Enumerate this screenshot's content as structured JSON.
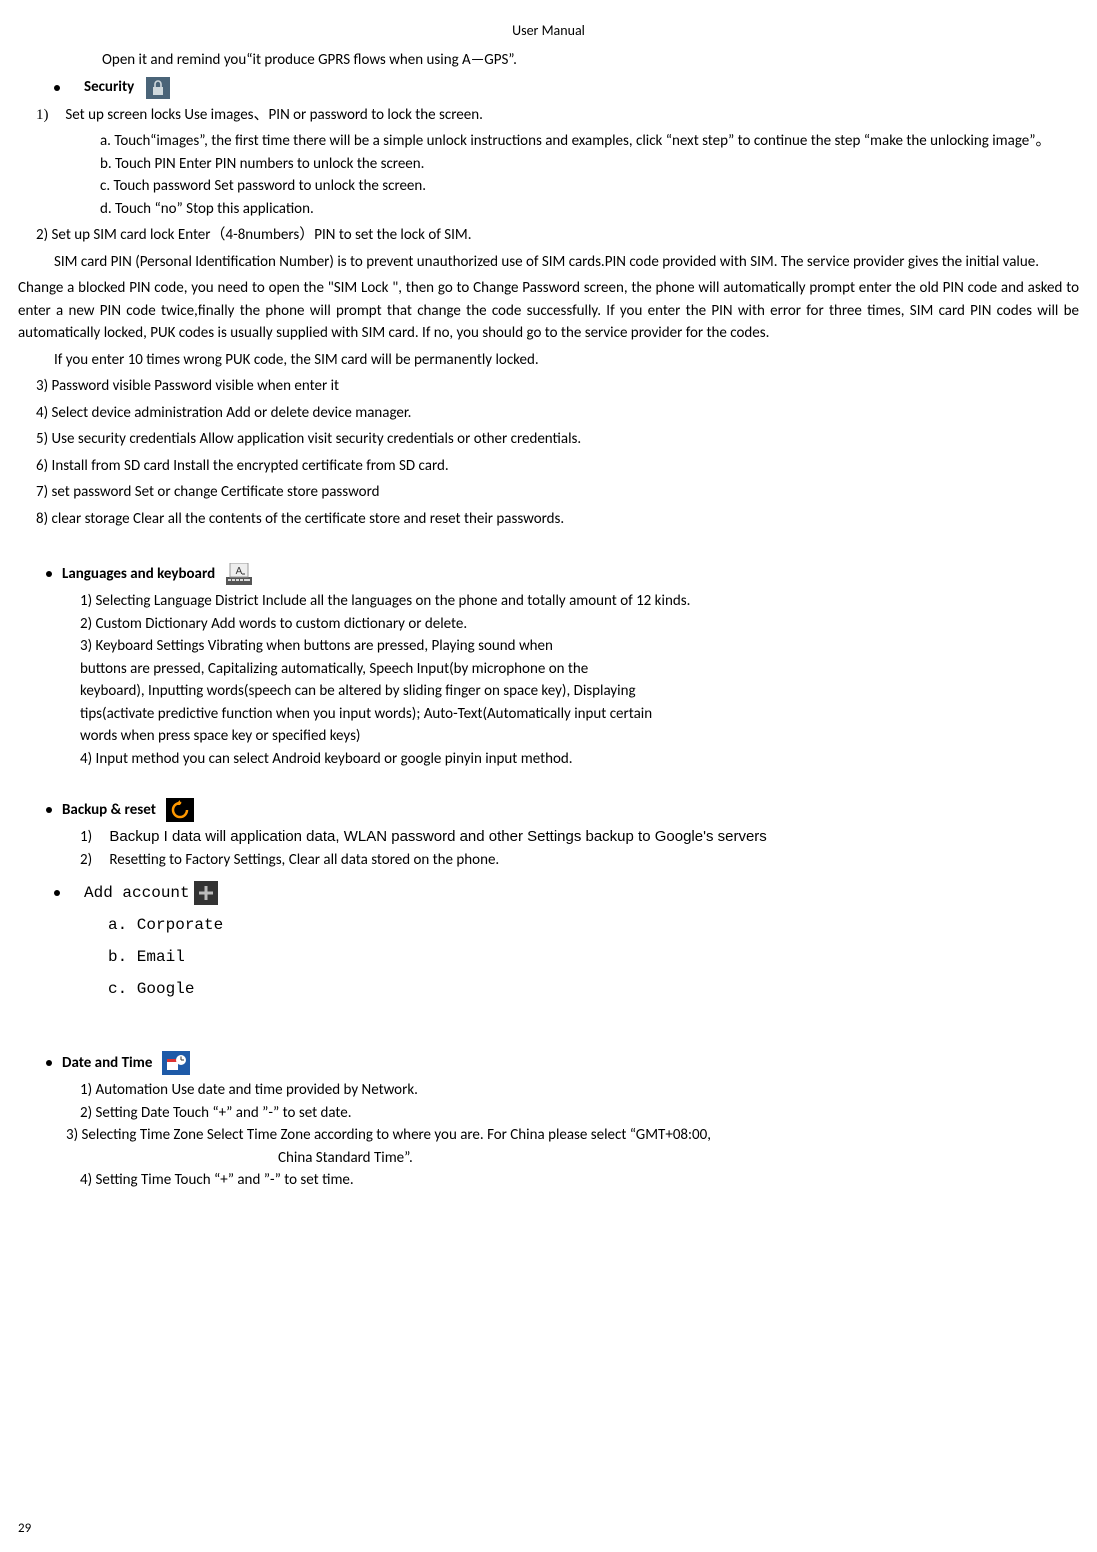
{
  "header": {
    "title": "User    Manual"
  },
  "intro": "Open it and remind you“it produce GPRS flows when using A—GPS”.",
  "security": {
    "label": "Security",
    "item1": {
      "num": "1)",
      "text": "Set up screen locks      Use images、PIN or password to lock the screen.",
      "a": "a. Touch“images”,    the first time there will be a simple unlock instructions and examples, click “next step” to continue the step “make the unlocking image”。",
      "b": "b. Touch PIN Enter PIN numbers to unlock the screen.",
      "c": "c. Touch password      Set password to unlock the screen.",
      "d": "d. Touch “no”      Stop this application."
    },
    "item2": "2)    Set up SIM card lock      Enter（4-8numbers）PIN to set the lock of SIM.",
    "simpin1": "SIM card PIN (Personal Identification Number) is to prevent unauthorized use of SIM cards.PIN code provided with SIM. The service provider gives the initial value.",
    "para_change": "Change a blocked PIN code, you need to open the \"SIM Lock \", then go to Change Password screen, the phone will automatically prompt enter the old PIN code and asked to enter a new PIN code twice,finally the phone will prompt that change the code successfully. If you enter the PIN with error for three times, SIM card PIN codes will be automatically locked, PUK codes is usually supplied with SIM card. If no, you should go to the service provider for the codes.",
    "para_puk": "If you enter 10 times wrong PUK code, the SIM card will be permanently locked.",
    "item3": "3)    Password visible        Password visible when enter it",
    "item4": "4)    Select device administration      Add or delete device manager.",
    "item5": "5)    Use security credentials        Allow application visit security credentials or other credentials.",
    "item6": "6)    Install from SD card      Install the encrypted certificate from SD card.",
    "item7": "7)    set password        Set or change Certificate store password",
    "item8": "8)    clear storage        Clear all the contents of the certificate store and reset their passwords."
  },
  "lang": {
    "label": "Languages and keyboard",
    "i1": "1) Selecting Language District        Include all the languages on the phone and totally amount of 12 kinds.",
    "i2": "2) Custom Dictionary          Add words to custom dictionary or delete.",
    "i3": "3) Keyboard Settings        Vibrating when buttons are pressed, Playing sound when",
    "i3b": "buttons are pressed, Capitalizing automatically, Speech Input(by microphone on the",
    "i3c": "keyboard), Inputting words(speech can be altered by sliding finger on space key), Displaying",
    "i3d": "tips(activate predictive function when you input words); Auto-Text(Automatically input certain",
    "i3e": "words when press space key or specified keys)",
    "i4": "4) Input method        you can select Android keyboard or google pinyin input method."
  },
  "backup": {
    "label": "Backup & reset",
    "i1n": "1)",
    "i1": "Backup I data will application data, WLAN password and other Settings backup to Google's servers",
    "i2n": "2)",
    "i2": "Resetting to Factory Settings, Clear all data stored on the phone."
  },
  "addacct": {
    "label": "Add account",
    "a": "a.  Corporate",
    "b": "b.  Email",
    "c": "c.  Google"
  },
  "datetime": {
    "label": "Date and Time",
    "i1": "1) Automation        Use date and time provided by Network.",
    "i2": "2) Setting Date       Touch “+” and ”-” to set date.",
    "i3a": "3) Selecting Time Zone       Select Time Zone according to where you are. For China please select “GMT+08:00,",
    "i3b": "China Standard Time”.",
    "i4": "4) Setting Time       Touch “+” and ”-” to set time."
  },
  "page": "29"
}
